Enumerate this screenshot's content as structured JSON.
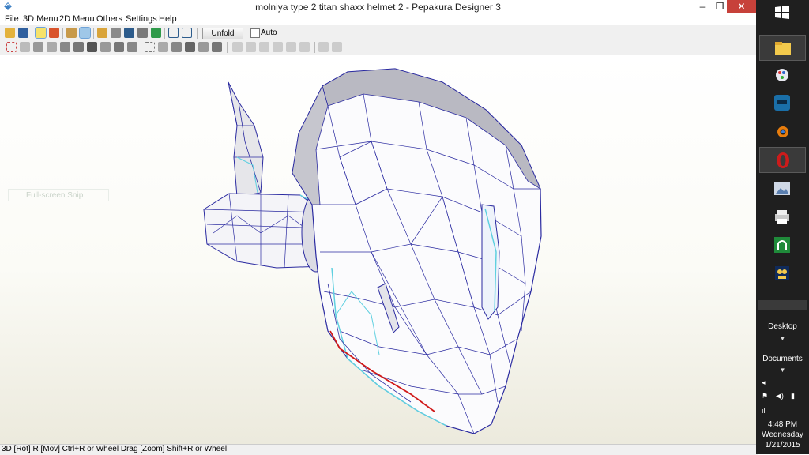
{
  "window": {
    "title": "molniya type 2 titan shaxx helmet 2  - Pepakura Designer 3",
    "controls": {
      "minimize": "–",
      "maximize": "❐",
      "close": "✕"
    }
  },
  "menubar": [
    "File",
    "3D Menu",
    "2D Menu",
    "Others",
    "Settings",
    "Help"
  ],
  "toolbar": {
    "unfold_label": "Unfold",
    "auto_label": "Auto",
    "auto_checked": false
  },
  "viewport": {
    "overlay_text": "Full-screen Snip",
    "model": "helmet-wireframe"
  },
  "status": {
    "text": "3D [Rot] R [Mov] Ctrl+R or Wheel Drag [Zoom] Shift+R or Wheel"
  },
  "taskbar": {
    "apps": [
      {
        "icon": "start-icon"
      },
      {
        "icon": "file-explorer-icon"
      },
      {
        "icon": "paint-icon"
      },
      {
        "icon": "blue-app-icon"
      },
      {
        "icon": "blender-icon"
      },
      {
        "icon": "opera-icon"
      },
      {
        "icon": "photo-viewer-icon"
      },
      {
        "icon": "printer-app-icon"
      },
      {
        "icon": "green-app-icon"
      },
      {
        "icon": "pepakura-icon"
      }
    ],
    "desktop_label": "Desktop",
    "documents_label": "Documents",
    "clock": {
      "time": "4:48 PM",
      "day": "Wednesday",
      "date": "1/21/2015"
    },
    "colors": {
      "background": "#1f1f1f",
      "opera": "#cc1b1b",
      "blender": "#e87d0d"
    }
  }
}
